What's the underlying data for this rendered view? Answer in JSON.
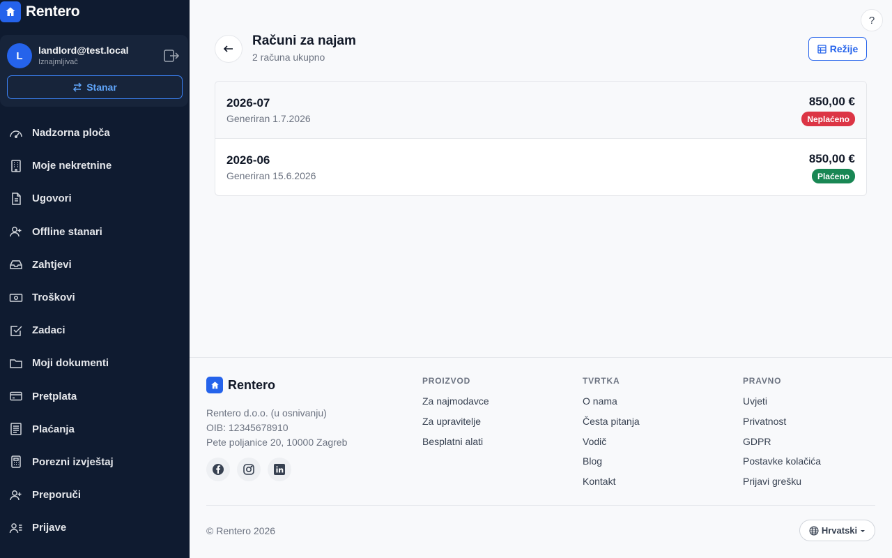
{
  "brand": {
    "name": "Rentero",
    "accent": "#2563eb"
  },
  "user": {
    "initial": "L",
    "email": "landlord@test.local",
    "role": "Iznajmljivač",
    "switch_label": "Stanar"
  },
  "sidebar": {
    "items": [
      {
        "label": "Nadzorna ploča",
        "icon": "dashboard-icon"
      },
      {
        "label": "Moje nekretnine",
        "icon": "building-icon"
      },
      {
        "label": "Ugovori",
        "icon": "document-icon"
      },
      {
        "label": "Offline stanari",
        "icon": "user-plus-icon"
      },
      {
        "label": "Zahtjevi",
        "icon": "inbox-icon"
      },
      {
        "label": "Troškovi",
        "icon": "cash-icon"
      },
      {
        "label": "Zadaci",
        "icon": "checkbox-icon"
      },
      {
        "label": "Moji dokumenti",
        "icon": "folder-icon"
      },
      {
        "label": "Pretplata",
        "icon": "card-icon"
      },
      {
        "label": "Plaćanja",
        "icon": "receipt-icon"
      },
      {
        "label": "Porezni izvještaj",
        "icon": "calculator-icon"
      },
      {
        "label": "Preporuči",
        "icon": "user-plus-icon"
      },
      {
        "label": "Prijave",
        "icon": "user-list-icon"
      }
    ]
  },
  "header": {
    "title": "Računi za najam",
    "subtitle": "2 računa ukupno",
    "rezije_label": "Režije",
    "help_label": "?"
  },
  "bills": [
    {
      "period": "2026-07",
      "generated": "Generiran 1.7.2026",
      "amount": "850,00 €",
      "status": "Neplaćeno",
      "status_color": "#dc3545"
    },
    {
      "period": "2026-06",
      "generated": "Generiran 15.6.2026",
      "amount": "850,00 €",
      "status": "Plaćeno",
      "status_color": "#198754"
    }
  ],
  "footer": {
    "brand": "Rentero",
    "company": "Rentero d.o.o. (u osnivanju)",
    "oib": "OIB: 12345678910",
    "address": "Pete poljanice 20, 10000 Zagreb",
    "social": [
      "facebook-icon",
      "instagram-icon",
      "linkedin-icon"
    ],
    "columns": [
      {
        "title": "PROIZVOD",
        "links": [
          "Za najmodavce",
          "Za upravitelje",
          "Besplatni alati"
        ]
      },
      {
        "title": "TVRTKA",
        "links": [
          "O nama",
          "Česta pitanja",
          "Vodič",
          "Blog",
          "Kontakt"
        ]
      },
      {
        "title": "PRAVNO",
        "links": [
          "Uvjeti",
          "Privatnost",
          "GDPR",
          "Postavke kolačića",
          "Prijavi grešku"
        ]
      }
    ],
    "copyright": "© Rentero 2026",
    "language": "Hrvatski"
  }
}
